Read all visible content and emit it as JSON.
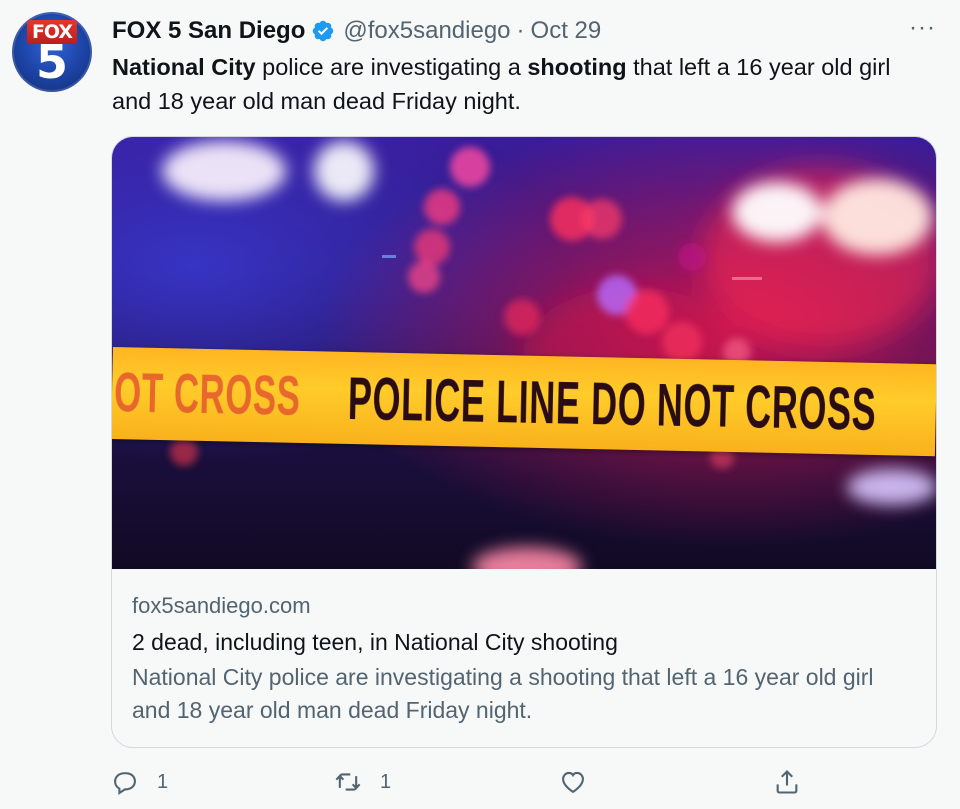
{
  "author": {
    "name": "FOX 5 San Diego",
    "handle": "@fox5sandiego",
    "separator": "·",
    "date": "Oct 29",
    "avatar_text_top": "FOX",
    "avatar_text_bottom": "5",
    "verified_icon": "verified-badge-icon"
  },
  "more_label": "···",
  "tweet": {
    "part1_bold": "National City",
    "part2": " police are investigating a ",
    "part3_bold": "shooting",
    "part4": " that left a 16 year old girl and 18 year old man dead Friday night."
  },
  "card": {
    "image_text_left": "IOT CROSS",
    "image_text_main": "POLICE LINE DO NOT CROSS",
    "domain": "fox5sandiego.com",
    "title": "2 dead, including teen, in National City shooting",
    "description": "National City police are investigating a shooting that left a 16 year old girl and 18 year old man dead Friday night."
  },
  "actions": {
    "reply_count": "1",
    "retweet_count": "1",
    "like_count": "",
    "share_label": ""
  },
  "colors": {
    "background": "#f7f9f9",
    "text_primary": "#0f1419",
    "text_secondary": "#536471",
    "verified": "#1d9bf0",
    "border": "#cfd9de"
  }
}
